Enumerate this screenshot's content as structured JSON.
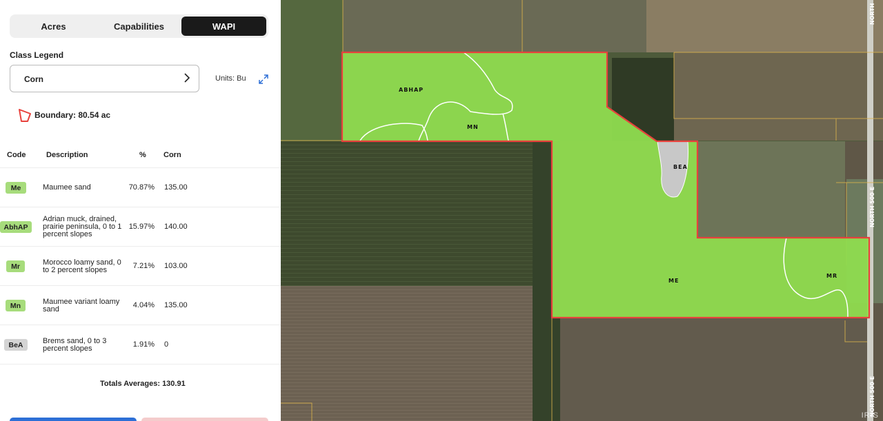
{
  "tabs": [
    {
      "label": "Acres",
      "active": false
    },
    {
      "label": "Capabilities",
      "active": false
    },
    {
      "label": "WAPI",
      "active": true
    }
  ],
  "legend": {
    "title": "Class Legend",
    "selected_crop": "Corn",
    "units": "Units: Bu"
  },
  "boundary": {
    "label": "Boundary: 80.54 ac"
  },
  "table": {
    "headers": {
      "code": "Code",
      "description": "Description",
      "percent": "%",
      "crop": "Corn"
    },
    "rows": [
      {
        "code": "Me",
        "description": "Maumee sand",
        "percent": "70.87%",
        "value": "135.00",
        "color": "#a7dc7c"
      },
      {
        "code": "AbhAP",
        "description": "Adrian muck, drained, prairie peninsula, 0 to 1 percent slopes",
        "percent": "15.97%",
        "value": "140.00",
        "color": "#a7dc7c"
      },
      {
        "code": "Mr",
        "description": "Morocco loamy sand, 0 to 2 percent slopes",
        "percent": "7.21%",
        "value": "103.00",
        "color": "#a7dc7c"
      },
      {
        "code": "Mn",
        "description": "Maumee variant loamy sand",
        "percent": "4.04%",
        "value": "135.00",
        "color": "#a7dc7c"
      },
      {
        "code": "BeA",
        "description": "Brems sand, 0 to 3 percent slopes",
        "percent": "1.91%",
        "value": "0",
        "color": "#d4d4d4"
      }
    ],
    "totals": "Totals Averages: 130.91"
  },
  "map": {
    "soil_labels": [
      "ABHAP",
      "MN",
      "BEA",
      "ME",
      "MR"
    ],
    "road_labels": [
      "NORTH 500 E",
      "NORTH 500 E",
      "NORTH"
    ],
    "watermark": "IRIS",
    "colors": {
      "soil_fill": "#8fdc4f",
      "boundary": "#e8413c",
      "gray_soil": "#c8c8c8"
    }
  }
}
